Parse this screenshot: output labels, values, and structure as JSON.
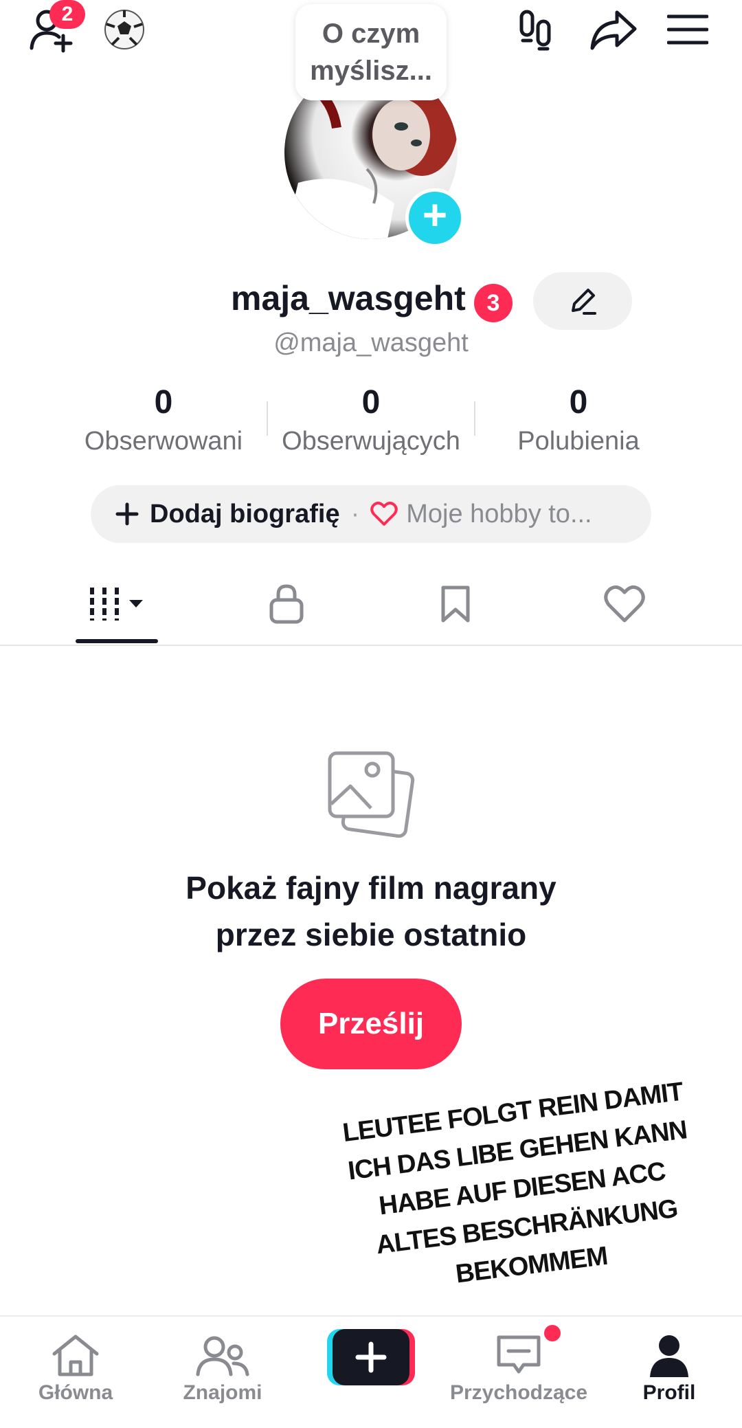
{
  "top_bar": {
    "friend_requests_badge": "2",
    "thought_bubble": "O czym myślisz..."
  },
  "profile": {
    "username": "maja_wasgeht",
    "username_badge": "3",
    "handle": "@maja_wasgeht",
    "stats": [
      {
        "value": "0",
        "label": "Obserwowani"
      },
      {
        "value": "0",
        "label": "Obserwujących"
      },
      {
        "value": "0",
        "label": "Polubienia"
      }
    ],
    "bio_button": {
      "add_label": "Dodaj biografię",
      "separator": "·",
      "hobby_label": "Moje hobby to..."
    }
  },
  "empty_state": {
    "title_line1": "Pokaż fajny film nagrany",
    "title_line2": "przez siebie ostatnio",
    "upload_label": "Prześlij"
  },
  "overlay_text": {
    "line1": "LEUTEE FOLGT REIN DAMIT",
    "line2": "ICH DAS LIBE GEHEN KANN",
    "line3": "HABE AUF DIESEN ACC",
    "line4": "ALTES BESCHRÄNKUNG",
    "line5": "BEKOMMEM"
  },
  "bottom_nav": {
    "home": "Główna",
    "friends": "Znajomi",
    "inbox": "Przychodzące",
    "profile": "Profil"
  },
  "colors": {
    "accent": "#fe2c55",
    "cyan": "#20d5ec",
    "text": "#161823",
    "muted": "#8a8b91"
  },
  "icons": [
    "add-friend-icon",
    "soccer-ball-icon",
    "footprints-icon",
    "share-icon",
    "menu-icon",
    "edit-pencil-icon",
    "heart-icon",
    "videos-grid-icon",
    "lock-icon",
    "bookmark-icon",
    "liked-heart-icon",
    "photos-icon",
    "home-icon",
    "friends-icon",
    "create-plus-icon",
    "inbox-icon",
    "profile-icon"
  ]
}
